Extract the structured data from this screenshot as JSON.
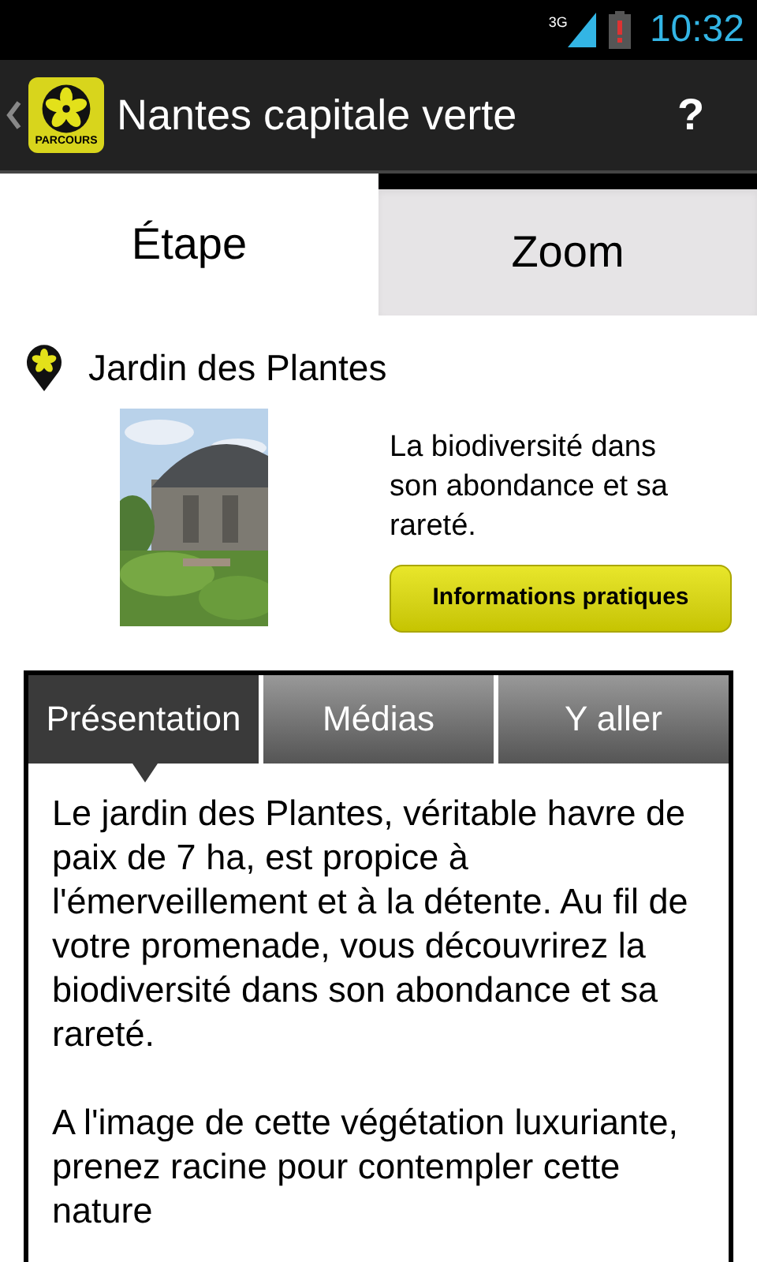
{
  "status_bar": {
    "network": "3G",
    "time": "10:32"
  },
  "action_bar": {
    "logo_label": "PARCOURS",
    "title": "Nantes capitale verte",
    "help": "?"
  },
  "tabs": [
    {
      "label": "Étape",
      "selected": true
    },
    {
      "label": "Zoom",
      "selected": false
    }
  ],
  "place": {
    "name": "Jardin des Plantes",
    "summary": "La biodiversité dans son abondance et sa rareté.",
    "button": "Informations pratiques"
  },
  "content_tabs": [
    {
      "label": "Présentation",
      "selected": true
    },
    {
      "label": "Médias",
      "selected": false
    },
    {
      "label": "Y aller",
      "selected": false
    }
  ],
  "paragraphs": [
    "Le jardin des Plantes, véritable havre de paix de 7 ha, est propice à l'émerveillement et à la détente. Au fil de votre promenade, vous découvrirez la biodiversité dans son abondance et sa rareté.",
    "A l'image de cette végétation luxuriante, prenez racine pour contempler cette nature"
  ]
}
